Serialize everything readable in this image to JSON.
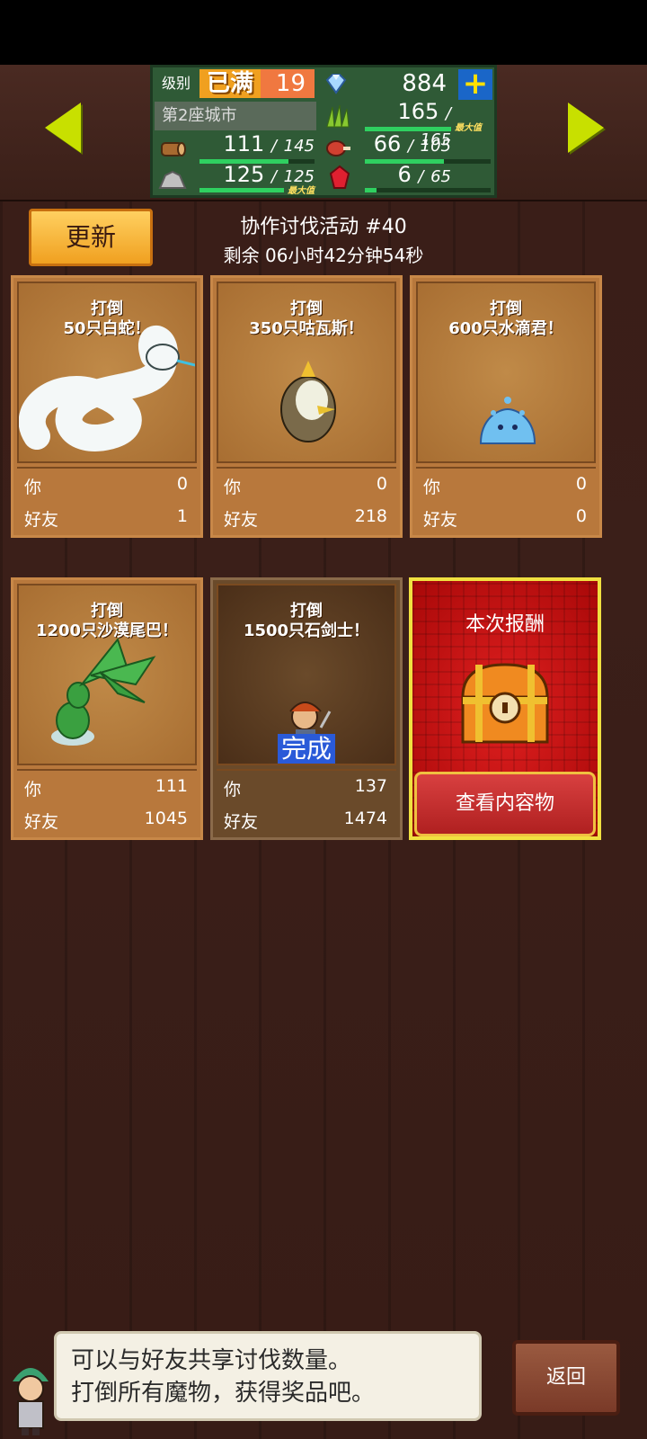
{
  "header": {
    "level_label": "级别",
    "level_max_label": "已满",
    "level_value": "19",
    "gems": "884",
    "plus_label": "+",
    "city_name": "第2座城市",
    "resources": {
      "wood": {
        "value": "111",
        "max": "145",
        "fill": 0.77
      },
      "stone": {
        "value": "125",
        "max": "125",
        "fill": 1.0,
        "max_tag": "最大值"
      },
      "grass": {
        "value": "165",
        "max": "165",
        "fill": 1.0,
        "max_tag": "最大值"
      },
      "meat": {
        "value": "66",
        "max": "105",
        "fill": 0.63
      },
      "ruby": {
        "value": "6",
        "max": "65",
        "fill": 0.09
      }
    },
    "separator": "/"
  },
  "toolbar": {
    "update_label": "更新"
  },
  "event": {
    "title": "协作讨伐活动 #40",
    "time_left": "剩余 06小时42分钟54秒"
  },
  "labels": {
    "you": "你",
    "friends": "好友"
  },
  "tasks": [
    {
      "line1": "打倒",
      "line2": "50只白蛇！",
      "you": "0",
      "friends": "1",
      "monster": "white-snake"
    },
    {
      "line1": "打倒",
      "line2": "350只咕瓦斯！",
      "you": "0",
      "friends": "218",
      "monster": "bird"
    },
    {
      "line1": "打倒",
      "line2": "600只水滴君！",
      "you": "0",
      "friends": "0",
      "monster": "water-slime"
    },
    {
      "line1": "打倒",
      "line2": "1200只沙漠尾巴！",
      "you": "111",
      "friends": "1045",
      "monster": "desert-plant"
    },
    {
      "line1": "打倒",
      "line2": "1500只石剑士！",
      "you": "137",
      "friends": "1474",
      "monster": "stone-swordsman",
      "status": "完成"
    }
  ],
  "reward": {
    "title": "本次报酬",
    "view_label": "查看内容物"
  },
  "footer": {
    "message_line1": "可以与好友共享讨伐数量。",
    "message_line2": "打倒所有魔物，获得奖品吧。",
    "back_label": "返回"
  },
  "colors": {
    "accent_green": "#2fd060",
    "nav_arrow": "#c8e000",
    "reward_red": "#c81414"
  }
}
